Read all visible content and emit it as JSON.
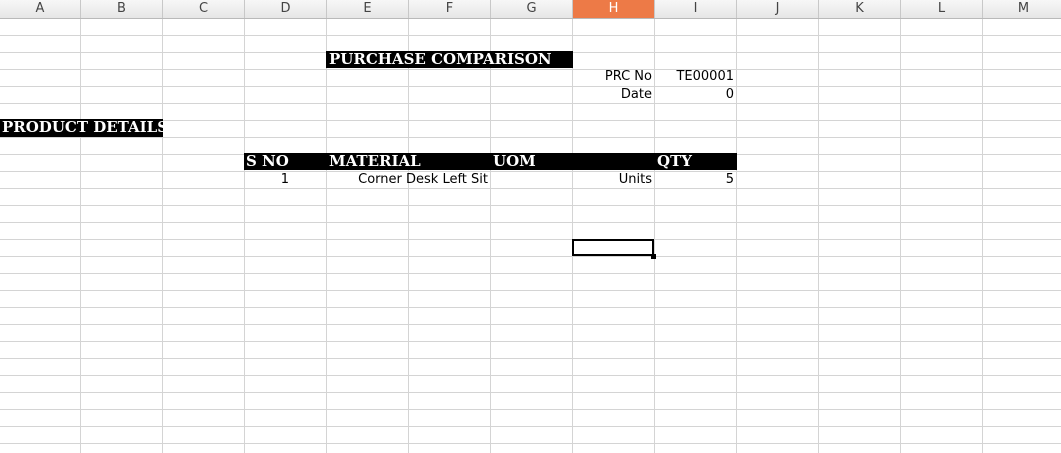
{
  "columns": [
    "A",
    "B",
    "C",
    "D",
    "E",
    "F",
    "G",
    "H",
    "I",
    "J",
    "K",
    "L",
    "M"
  ],
  "active_column": "H",
  "sheet": {
    "title": "PURCHASE  COMPARISON",
    "prc_no_label": "PRC No",
    "prc_no_value": "TE00001",
    "date_label": "Date",
    "date_value": "0",
    "section_title": "PRODUCT DETAILS",
    "table": {
      "headers": {
        "sno": "S NO",
        "material": "MATERIAL",
        "uom": "UOM",
        "qty": "QTY"
      },
      "rows": [
        {
          "sno": "1",
          "material": "Corner Desk Left Sit",
          "uom": "Units",
          "qty": "5"
        }
      ]
    }
  }
}
